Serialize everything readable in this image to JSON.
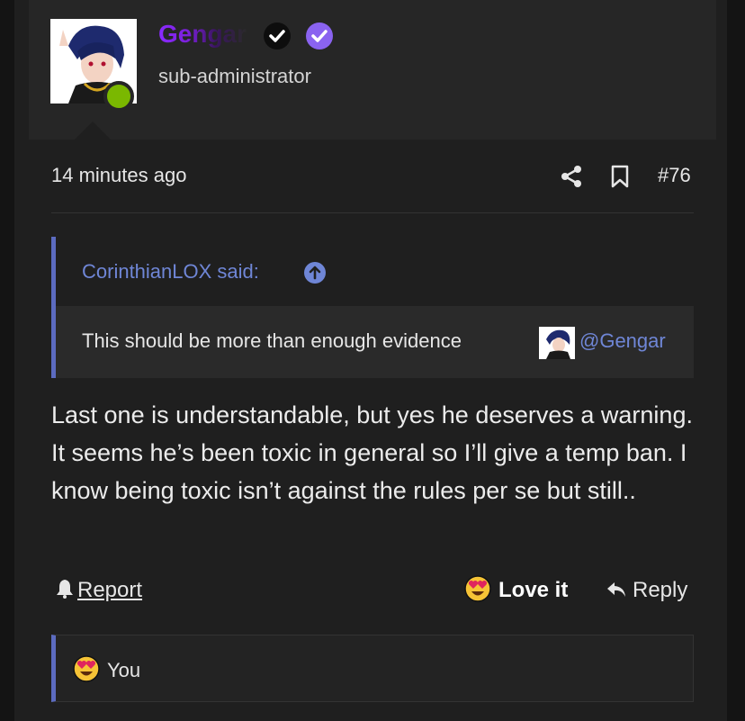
{
  "user": {
    "name": "Gengar",
    "title": "sub-administrator",
    "name_gradient": [
      "#8a2bff",
      "#2a2a2a"
    ],
    "online_color": "#7ab800"
  },
  "post": {
    "time": "14 minutes ago",
    "number": "#76",
    "text": "Last one is understandable, but yes he deserves a warning. It seems he’s been toxic in general so I’ll give a temp ban. I know being toxic isn’t against the rules per se but still.."
  },
  "quote": {
    "author": "CorinthianLOX said:",
    "text": "This should be more than enough evidence",
    "mention": "@Gengar"
  },
  "actions": {
    "report": "Report",
    "love": "Love it",
    "reply": "Reply"
  },
  "reactions": {
    "summary": "You"
  },
  "colors": {
    "accent": "#5c6bc0",
    "link": "#6f86d6",
    "verified": "#8a63f0"
  },
  "icons": [
    "share-icon",
    "bookmark-icon",
    "bell-icon",
    "heart-eyes-icon",
    "reply-icon",
    "arrow-up-circle-icon",
    "verified-icon"
  ]
}
